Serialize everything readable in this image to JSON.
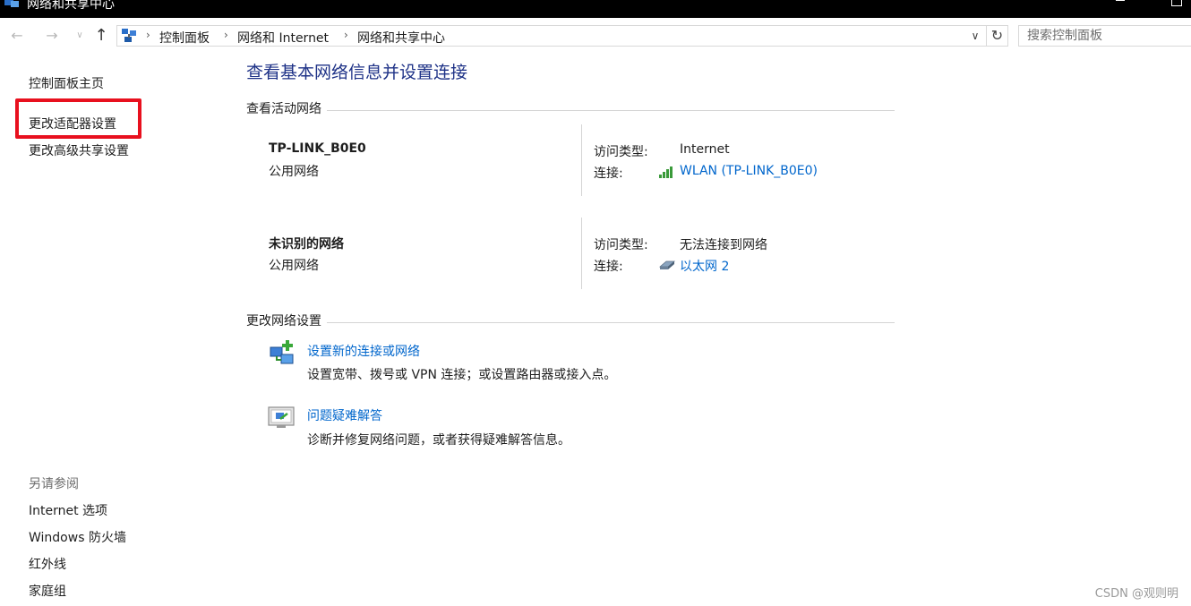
{
  "window": {
    "title": "网络和共享中心",
    "icon": "network-center-icon"
  },
  "address_bar": {
    "breadcrumbs": [
      "控制面板",
      "网络和 Internet",
      "网络和共享中心"
    ],
    "search_placeholder": "搜索控制面板"
  },
  "sidebar": {
    "links": [
      "控制面板主页",
      "更改适配器设置",
      "更改高级共享设置"
    ],
    "highlighted_index": 1,
    "see_also_title": "另请参阅",
    "see_also": [
      "Internet 选项",
      "Windows 防火墙",
      "红外线",
      "家庭组"
    ]
  },
  "main": {
    "title": "查看基本网络信息并设置连接",
    "active_networks_header": "查看活动网络",
    "networks": [
      {
        "name": "TP-LINK_B0E0",
        "category": "公用网络",
        "access_label": "访问类型:",
        "access_value": "Internet",
        "connection_label": "连接:",
        "connection_value": "WLAN (TP-LINK_B0E0)",
        "connection_icon": "wifi-signal-icon"
      },
      {
        "name": "未识别的网络",
        "category": "公用网络",
        "access_label": "访问类型:",
        "access_value": "无法连接到网络",
        "connection_label": "连接:",
        "connection_value": "以太网 2",
        "connection_icon": "ethernet-icon"
      }
    ],
    "change_settings_header": "更改网络设置",
    "tasks": [
      {
        "link": "设置新的连接或网络",
        "description": "设置宽带、拨号或 VPN 连接；或设置路由器或接入点。",
        "icon": "new-connection-icon"
      },
      {
        "link": "问题疑难解答",
        "description": "诊断并修复网络问题，或者获得疑难解答信息。",
        "icon": "troubleshoot-icon"
      }
    ]
  },
  "watermark": "CSDN @观则明",
  "colors": {
    "link": "#0066cc",
    "title": "#1e3287",
    "highlight": "#e8101e",
    "wifi_signal": "#3a9a3a"
  }
}
